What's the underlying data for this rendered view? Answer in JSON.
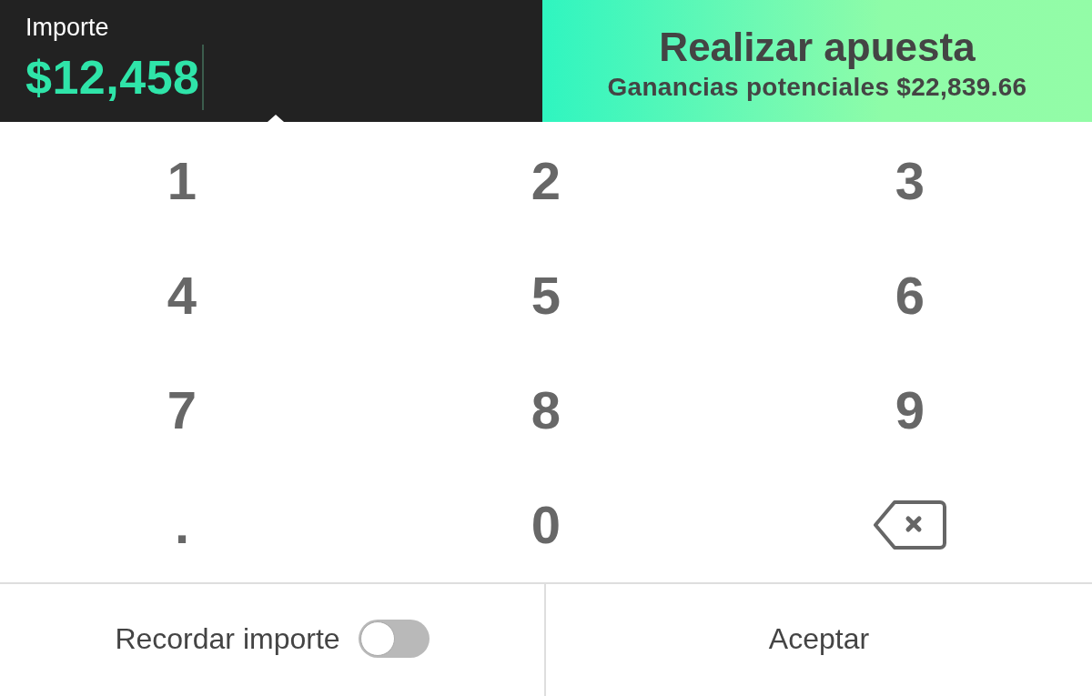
{
  "amount_field": {
    "label": "Importe",
    "value": "$12,458",
    "focused": true
  },
  "place_bet_button": {
    "label": "Realizar apuesta",
    "potential_winnings": "Ganancias potenciales $22,839.66"
  },
  "keypad": {
    "keys": [
      {
        "kind": "char",
        "label": "1"
      },
      {
        "kind": "char",
        "label": "2"
      },
      {
        "kind": "char",
        "label": "3"
      },
      {
        "kind": "char",
        "label": "4"
      },
      {
        "kind": "char",
        "label": "5"
      },
      {
        "kind": "char",
        "label": "6"
      },
      {
        "kind": "char",
        "label": "7"
      },
      {
        "kind": "char",
        "label": "8"
      },
      {
        "kind": "char",
        "label": "9"
      },
      {
        "kind": "char",
        "label": "."
      },
      {
        "kind": "char",
        "label": "0"
      },
      {
        "kind": "backspace"
      }
    ]
  },
  "bottom_bar": {
    "remember_toggle": {
      "label": "Recordar importe",
      "on": false
    },
    "accept_button": {
      "label": "Aceptar"
    }
  }
}
